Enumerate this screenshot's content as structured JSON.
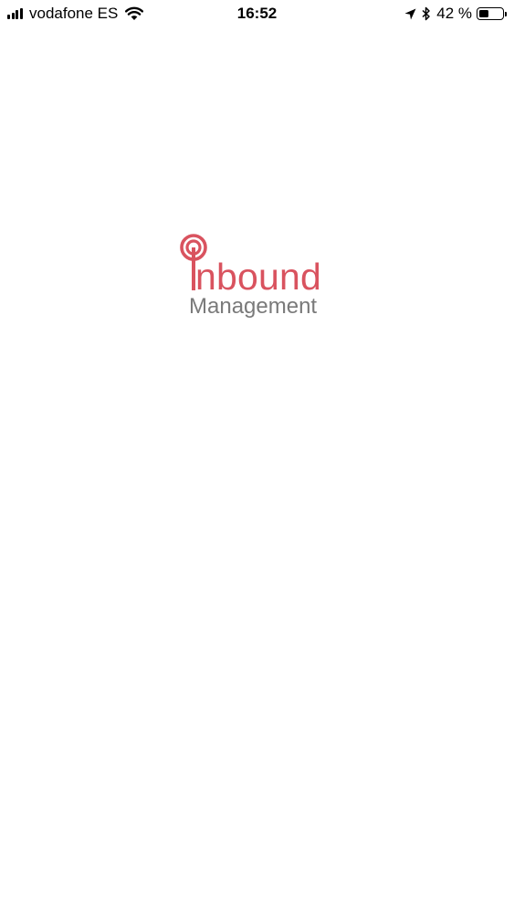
{
  "status_bar": {
    "carrier": "vodafone ES",
    "time": "16:52",
    "battery_percent": "42 %",
    "battery_level": 0.42,
    "icons": [
      "signal-icon",
      "wifi-icon",
      "location-arrow-icon",
      "bluetooth-icon",
      "battery-icon"
    ]
  },
  "splash": {
    "logo_word": "nbound",
    "logo_subtitle": "Management",
    "logo_color": "#d9535f",
    "subtitle_color": "#7a7a7a"
  }
}
